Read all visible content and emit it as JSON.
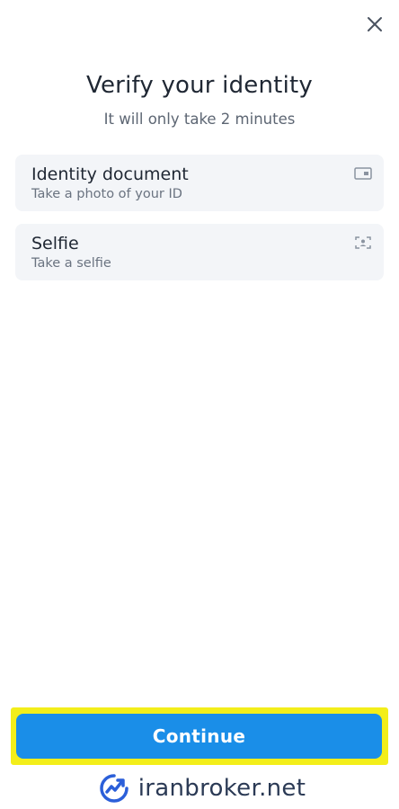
{
  "header": {
    "close_icon": "close-icon"
  },
  "main": {
    "title": "Verify your identity",
    "subtitle": "It will only take 2 minutes",
    "options": [
      {
        "title": "Identity document",
        "subtitle": "Take a photo of your ID",
        "icon": "id-card-icon"
      },
      {
        "title": "Selfie",
        "subtitle": "Take a selfie",
        "icon": "face-scan-icon"
      }
    ]
  },
  "footer": {
    "continue_label": "Continue",
    "highlight_color": "#f3ee1a",
    "button_color": "#1a8ee8"
  },
  "watermark": {
    "text": "iranbroker.net",
    "logo": "iranbroker-logo"
  }
}
